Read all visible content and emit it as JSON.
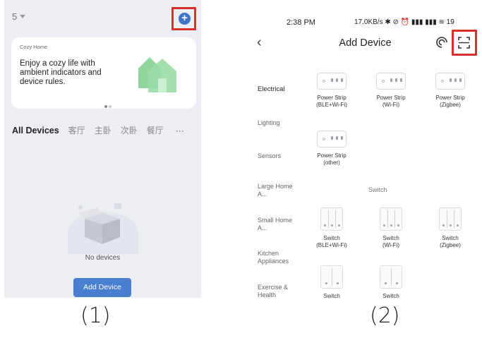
{
  "panel1": {
    "home_selector": "5",
    "add_icon": "plus-circle-icon",
    "banner": {
      "tag": "Cozy Home",
      "text": "Enjoy a cozy life with ambient indicators and device rules."
    },
    "tabs": [
      "All Devices",
      "客厅",
      "主卧",
      "次卧",
      "餐厅",
      "···"
    ],
    "empty_text": "No devices",
    "add_button": "Add Device",
    "caption": "(1)"
  },
  "panel2": {
    "status": {
      "time": "2:38 PM",
      "right": "17.0KB/s ✱ ⊘ ⏰ ▮▮▮ ▮▮▮ ≋ 19"
    },
    "title": "Add Device",
    "categories": [
      "Electrical",
      "Lighting",
      "Sensors",
      "Large Home A...",
      "Small Home A...",
      "Kitchen Appliances",
      "Exercise & Health"
    ],
    "power_strips": [
      {
        "name": "Power Strip",
        "sub": "(BLE+Wi-Fi)"
      },
      {
        "name": "Power Strip",
        "sub": "(Wi-Fi)"
      },
      {
        "name": "Power Strip",
        "sub": "(Zigbee)"
      },
      {
        "name": "Power Strip",
        "sub": "(other)"
      }
    ],
    "section_switch": "Switch",
    "switches": [
      {
        "name": "Switch",
        "sub": "(BLE+Wi-Fi)"
      },
      {
        "name": "Switch",
        "sub": "(Wi-Fi)"
      },
      {
        "name": "Switch",
        "sub": "(Zigbee)"
      },
      {
        "name": "Switch",
        "sub": ""
      },
      {
        "name": "Switch",
        "sub": ""
      }
    ],
    "caption": "(2)"
  },
  "colors": {
    "accent": "#4a7fd0",
    "highlight": "#d8302a"
  }
}
